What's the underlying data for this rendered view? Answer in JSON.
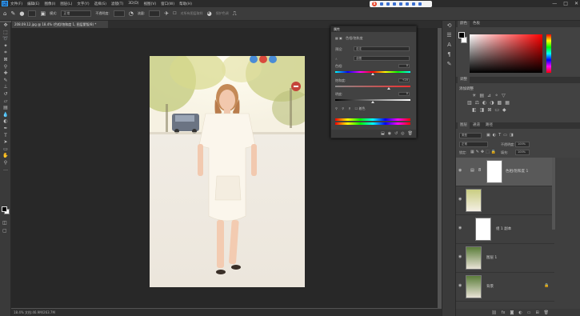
{
  "menubar": {
    "logo": "Ps",
    "items": [
      "文件(F)",
      "编辑(E)",
      "图像(I)",
      "图层(L)",
      "文字(Y)",
      "选择(S)",
      "滤镜(T)",
      "3D(D)",
      "视图(V)",
      "窗口(W)",
      "帮助(H)"
    ],
    "window_controls": [
      "—",
      "□",
      "✕"
    ]
  },
  "ime": {
    "label": "S"
  },
  "options_bar": {
    "mode_label": "模式:",
    "mode_value": "正常",
    "opacity_label": "不透明度:",
    "opacity_value": "",
    "flow_label": "流量:",
    "checkbox_label": "对所有图层取样",
    "size_value": "",
    "extra_label": "保护色调"
  },
  "document": {
    "tab_title": "208.09.12.jpg @ 18.4% (色相/饱和度 1, 图层蒙版/8) *",
    "status_text": "18.4%   文档:46.9M/263.7M"
  },
  "properties_panel": {
    "title": "属性",
    "section": "色相/饱和度",
    "preset_label": "预设:",
    "preset_value": "自定",
    "channel_value": "全图",
    "hue_label": "色相:",
    "hue_value": "0",
    "saturation_label": "饱和度:",
    "saturation_value": "+20",
    "lightness_label": "明度:",
    "lightness_value": "0",
    "hue_thumb_fraction": 0.5,
    "saturation_thumb_fraction": 0.71,
    "lightness_thumb_fraction": 0.5,
    "colorize_label": "着色"
  },
  "color_panel": {
    "tabs": [
      "颜色",
      "色板"
    ],
    "fg_color": "#000000",
    "bg_color": "#ffffff"
  },
  "adjustments_panel": {
    "tab": "调整",
    "title": "添加调整"
  },
  "layers_panel": {
    "tabs": [
      "图层",
      "通道",
      "路径"
    ],
    "filter_label": "类型",
    "blend_mode": "正常",
    "opacity_label": "不透明度:",
    "opacity_value": "100%",
    "lock_label": "锁定:",
    "fill_label": "填充:",
    "fill_value": "100%",
    "layers": [
      {
        "name": "色相/饱和度 1",
        "selected": true
      },
      {
        "name": "",
        "selected": false
      },
      {
        "name": "组 1 副本",
        "selected": false
      },
      {
        "name": "图层 1",
        "selected": false
      },
      {
        "name": "背景",
        "selected": false
      }
    ]
  },
  "colors": {
    "accent": "#31a8ff",
    "panel_bg": "#424242",
    "selected_layer": "#595959"
  }
}
